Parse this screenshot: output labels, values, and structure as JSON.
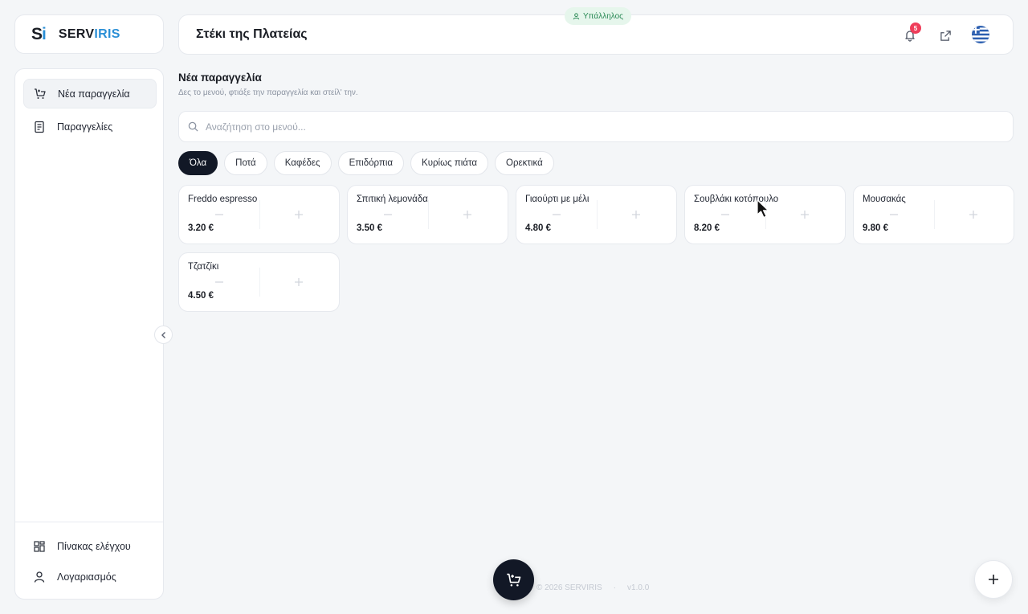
{
  "logo": {
    "mark_s": "S",
    "mark_i": "i",
    "name_part1": "SERV",
    "name_part2": "IRIS"
  },
  "header": {
    "title": "Στέκι της Πλατείας",
    "role_badge": "Υπάλληλος",
    "notification_count": "5",
    "language_flag": "greek-flag"
  },
  "sidebar": {
    "items": [
      {
        "label": "Νέα παραγγελία",
        "icon": "cart-plus-icon",
        "active": true
      },
      {
        "label": "Παραγγελίες",
        "icon": "receipt-icon",
        "active": false
      }
    ],
    "bottom_items": [
      {
        "label": "Πίνακας ελέγχου",
        "icon": "dashboard-icon"
      },
      {
        "label": "Λογαριασμός",
        "icon": "user-icon"
      }
    ]
  },
  "main": {
    "title": "Νέα παραγγελία",
    "subtitle": "Δες το μενού, φτιάξε την παραγγελία και στείλ' την.",
    "search": {
      "placeholder": "Αναζήτηση στο μενού...",
      "value": ""
    },
    "categories": [
      "Όλα",
      "Ποτά",
      "Καφέδες",
      "Επιδόρπια",
      "Κυρίως πιάτα",
      "Ορεκτικά"
    ],
    "active_category": "Όλα",
    "products": [
      {
        "name": "Freddo espresso",
        "price": "3.20 €"
      },
      {
        "name": "Σπιτική λεμονάδα",
        "price": "3.50 €"
      },
      {
        "name": "Γιαούρτι με μέλι",
        "price": "4.80 €"
      },
      {
        "name": "Σουβλάκι κοτόπουλο",
        "price": "8.20 €"
      },
      {
        "name": "Μουσακάς",
        "price": "9.80 €"
      },
      {
        "name": "Τζατζίκι",
        "price": "4.50 €"
      }
    ]
  },
  "footer": {
    "copyright": "© 2026 SERVIRIS",
    "separator": "·",
    "version": "v1.0.0"
  },
  "colors": {
    "accent": "#2b8fd6",
    "dark": "#121826",
    "badge_bg": "#e6f6ec",
    "badge_text": "#2a8a55",
    "notif": "#ef3d5a"
  }
}
